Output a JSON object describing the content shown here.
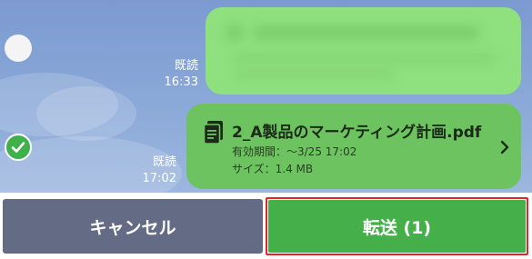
{
  "messages": [
    {
      "read_label": "既読",
      "time": "16:33",
      "selected": false
    },
    {
      "read_label": "既読",
      "time": "17:02",
      "selected": true,
      "file": {
        "name": "2_A製品のマーケティング計画.pdf",
        "expiry": "有効期間：～3/25 17:02",
        "size": "サイズ：1.4 MB",
        "icon": "document-icon"
      }
    }
  ],
  "actions": {
    "cancel_label": "キャンセル",
    "forward_label": "転送 (1)"
  },
  "colors": {
    "bubble_green": "#8fe07f",
    "file_bubble_green": "#6cc35f",
    "cancel_gray": "#636c84",
    "forward_green": "#45b04a",
    "highlight_red": "#e0262b",
    "check_green": "#3fb04a"
  }
}
